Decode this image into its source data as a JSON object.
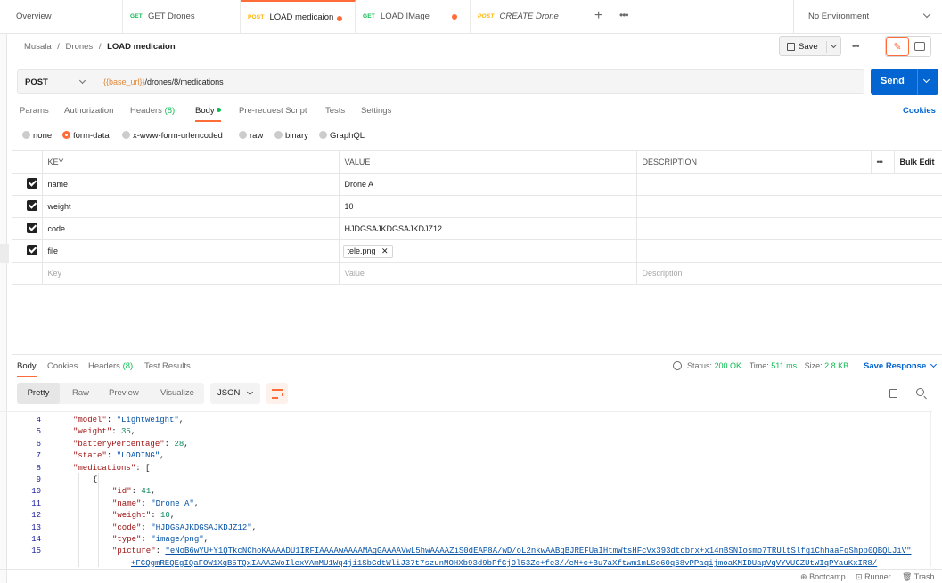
{
  "tabs": [
    {
      "method": "",
      "label": "Overview"
    },
    {
      "method": "GET",
      "label": "GET Drones"
    },
    {
      "method": "POST",
      "label": "LOAD medicaion"
    },
    {
      "method": "GET",
      "label": "LOAD IMage"
    },
    {
      "method": "POST",
      "label": "CREATE Drone"
    }
  ],
  "environment": "No Environment",
  "breadcrumb": {
    "a": "Musala",
    "b": "Drones",
    "c": "LOAD medicaion",
    "sep": "/"
  },
  "save_label": "Save",
  "request": {
    "method": "POST",
    "url_var": "{{base_url}}",
    "url_path": "/drones/8/medications",
    "send": "Send"
  },
  "req_tabs": {
    "params": "Params",
    "auth": "Authorization",
    "headers": "Headers",
    "headers_count": "(8)",
    "body": "Body",
    "prereq": "Pre-request Script",
    "tests": "Tests",
    "settings": "Settings",
    "cookies": "Cookies"
  },
  "body_types": [
    "none",
    "form-data",
    "x-www-form-urlencoded",
    "raw",
    "binary",
    "GraphQL"
  ],
  "table": {
    "key": "KEY",
    "value": "VALUE",
    "description": "DESCRIPTION",
    "bulk": "Bulk Edit",
    "rows": [
      {
        "k": "name",
        "v": "Drone A"
      },
      {
        "k": "weight",
        "v": "10"
      },
      {
        "k": "code",
        "v": "HJDGSAJKDGSAJKDJZ12"
      },
      {
        "k": "file",
        "v": "tele.png"
      }
    ],
    "ph_key": "Key",
    "ph_value": "Value",
    "ph_desc": "Description"
  },
  "resp_tabs": {
    "body": "Body",
    "cookies": "Cookies",
    "headers": "Headers",
    "headers_count": "(8)",
    "tests": "Test Results"
  },
  "status": {
    "status_label": "Status:",
    "status": "200 OK",
    "time_label": "Time:",
    "time": "511 ms",
    "size_label": "Size:",
    "size": "2.8 KB",
    "save": "Save Response"
  },
  "view_modes": {
    "pretty": "Pretty",
    "raw": "Raw",
    "preview": "Preview",
    "visualize": "Visualize",
    "format": "JSON"
  },
  "code_lines": [
    {
      "n": "4",
      "ind": 1,
      "k": "\"model\"",
      "v": "\"Lightweight\"",
      "t": "s",
      "c": ","
    },
    {
      "n": "5",
      "ind": 1,
      "k": "\"weight\"",
      "v": "35",
      "t": "n",
      "c": ","
    },
    {
      "n": "6",
      "ind": 1,
      "k": "\"batteryPercentage\"",
      "v": "28",
      "t": "n",
      "c": ","
    },
    {
      "n": "7",
      "ind": 1,
      "k": "\"state\"",
      "v": "\"LOADING\"",
      "t": "s",
      "c": ","
    },
    {
      "n": "8",
      "ind": 1,
      "k": "\"medications\"",
      "v": "[",
      "t": "p",
      "c": ""
    },
    {
      "n": "9",
      "ind": 2,
      "k": "",
      "v": "{",
      "t": "p",
      "c": ""
    },
    {
      "n": "10",
      "ind": 3,
      "k": "\"id\"",
      "v": "41",
      "t": "n",
      "c": ","
    },
    {
      "n": "11",
      "ind": 3,
      "k": "\"name\"",
      "v": "\"Drone A\"",
      "t": "s",
      "c": ","
    },
    {
      "n": "12",
      "ind": 3,
      "k": "\"weight\"",
      "v": "10",
      "t": "n",
      "c": ","
    },
    {
      "n": "13",
      "ind": 3,
      "k": "\"code\"",
      "v": "\"HJDGSAJKDGSAJKDJZ12\"",
      "t": "s",
      "c": ","
    },
    {
      "n": "14",
      "ind": 3,
      "k": "\"type\"",
      "v": "\"image/png\"",
      "t": "s",
      "c": ","
    },
    {
      "n": "15",
      "ind": 3,
      "k": "\"picture\"",
      "v": "\"eNoB6wYU+Y1QTkcNChoKAAAADU1IRFIAAAAwAAAAMAgGAAAAVwL5hwAAAAZiS0dEAP8A/wD/oL2nkwAABqBJREFUaIHtmWtsHFcVx393dtcbrx+x14nBSNIosmo7TRUltSlfgiChhaaFqShpp0QBQLJiV\"",
      "t": "s",
      "c": ""
    },
    {
      "n": "",
      "ind": 3,
      "k": "",
      "v": "+FCQgmREQEgIQaFOW1XqB5TQxIAAAZWoIlexVAmMU1Wq4ji1SbGdtWliJ37t7szunMOHXb93d9bPfGjOl53Zc+fe3//eM+c+Bu7aXftwm1mLSo60q68vPPaqijmoaKMIDUapVqVYVUGZUtWIqPYauKxIR8/",
      "t": "u",
      "c": ""
    }
  ],
  "footer": {
    "bootcamp": "Bootcamp",
    "runner": "Runner",
    "trash": "Trash"
  }
}
